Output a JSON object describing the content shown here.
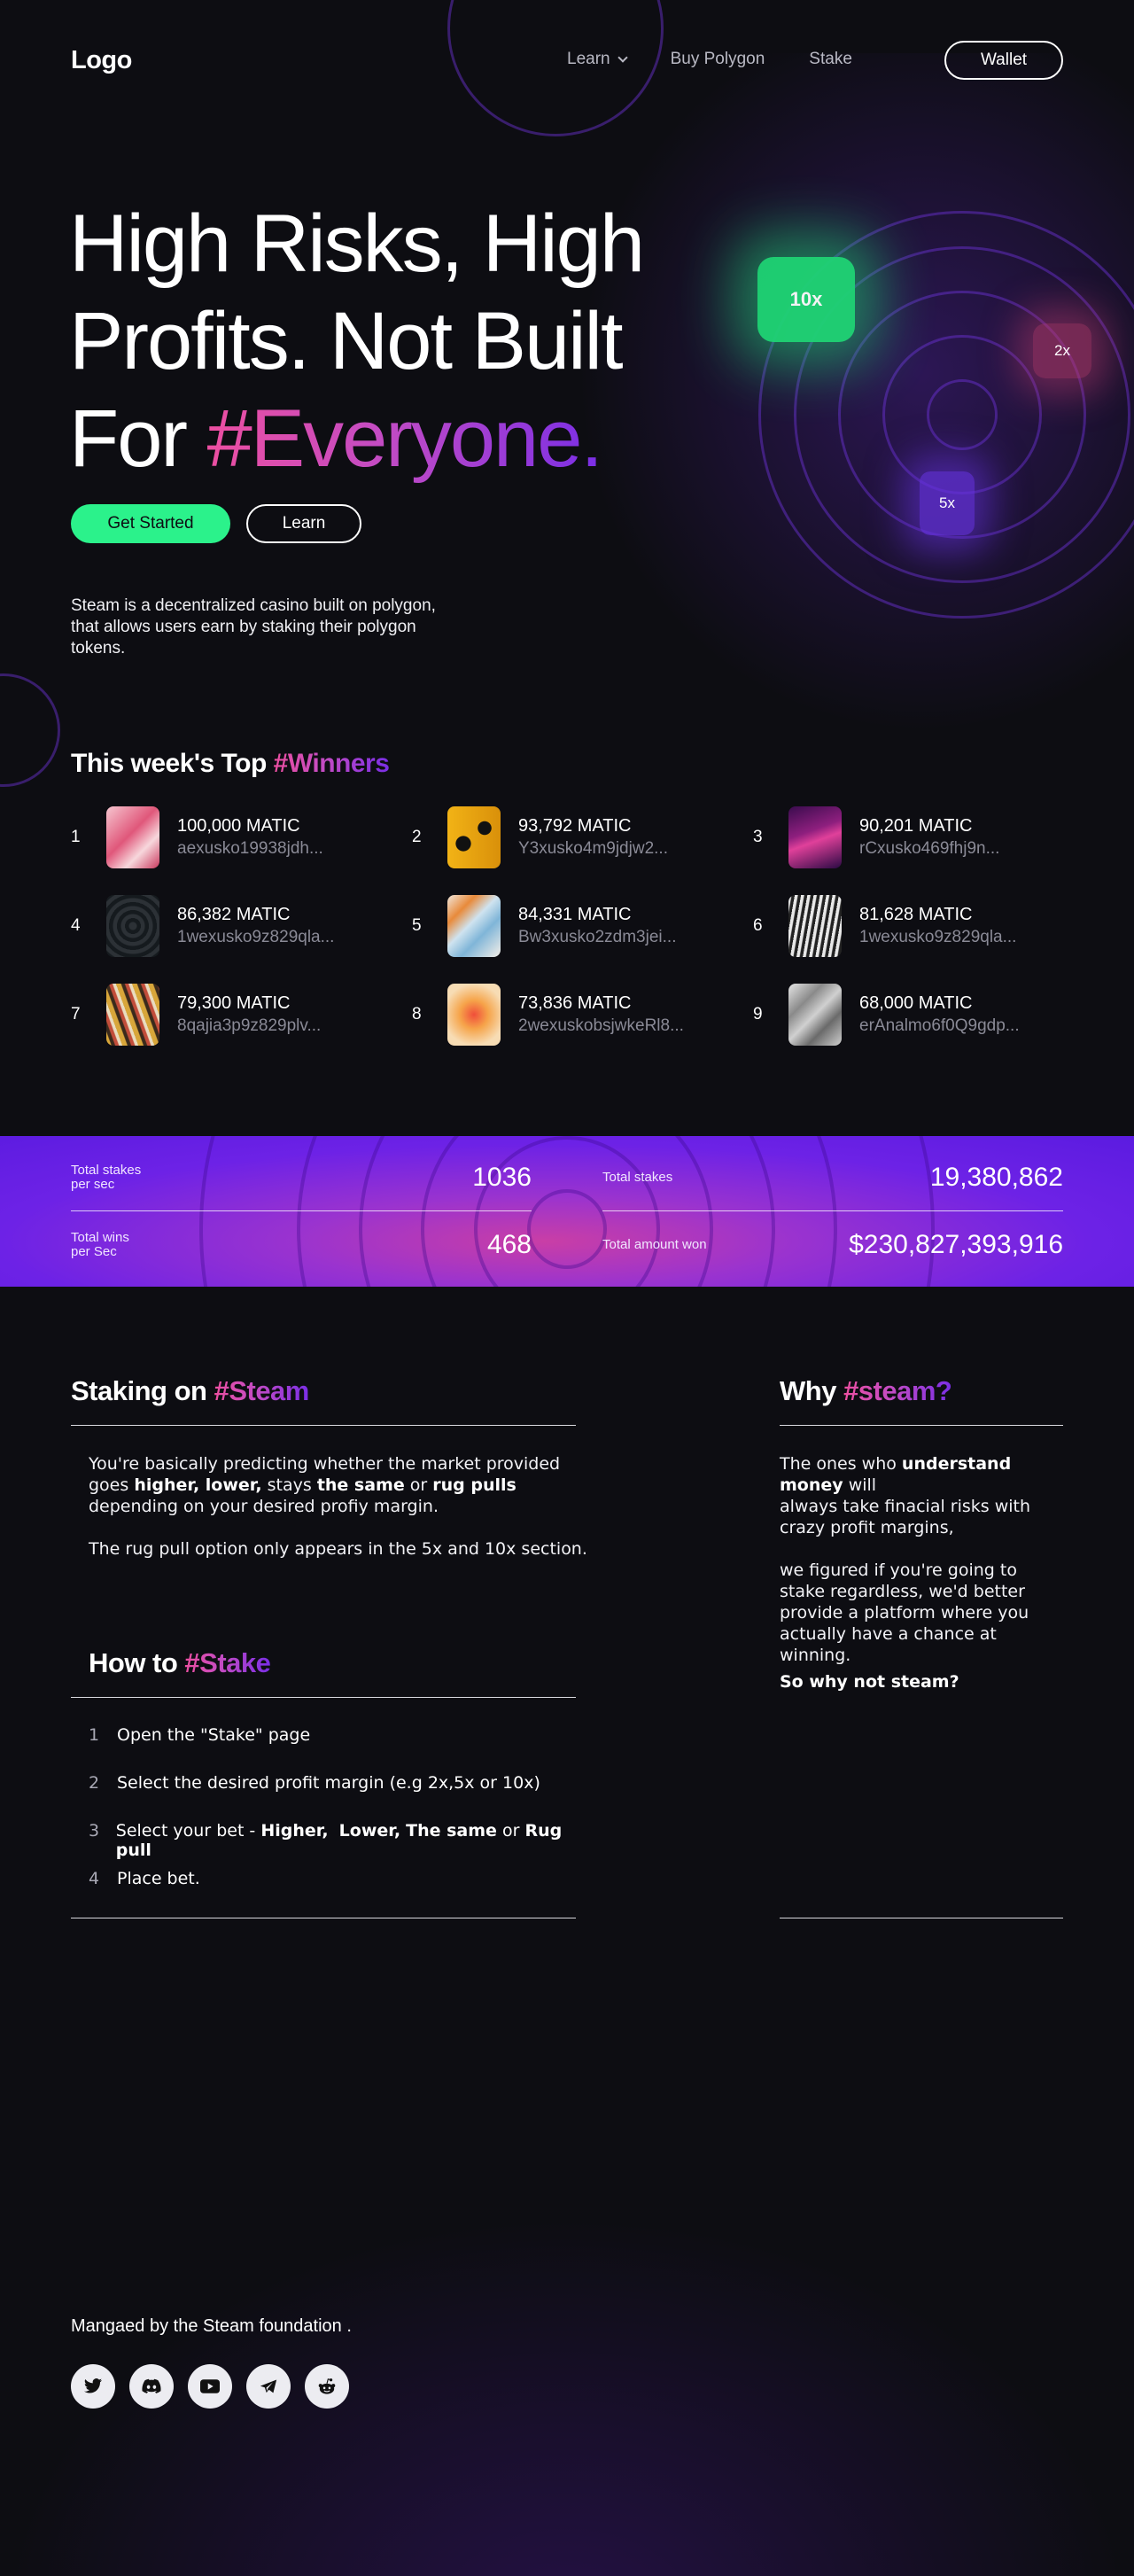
{
  "header": {
    "logo": "Logo",
    "nav": [
      {
        "label": "Learn",
        "has_dropdown": true
      },
      {
        "label": "Buy Polygon"
      },
      {
        "label": "Stake"
      }
    ],
    "wallet_label": "Wallet"
  },
  "hero": {
    "title_line1": "High Risks, High",
    "title_line2": "Profits. Not Built",
    "title_line3_plain": "For ",
    "title_line3_accent": "#Everyone.",
    "primary_button": "Get Started",
    "secondary_button": "Learn",
    "description": "Steam is a decentralized casino built on polygon, that allows users earn by staking their polygon tokens.",
    "multipliers": [
      "10x",
      "2x",
      "5x"
    ]
  },
  "winners": {
    "title_plain": "This week's Top ",
    "title_accent": "#Winners",
    "items": [
      {
        "rank": "1",
        "amount": "100,000 MATIC",
        "address": "aexusko19938jdh..."
      },
      {
        "rank": "2",
        "amount": "93,792 MATIC",
        "address": "Y3xusko4m9jdjw2..."
      },
      {
        "rank": "3",
        "amount": "90,201 MATIC",
        "address": "rCxusko469fhj9n..."
      },
      {
        "rank": "4",
        "amount": "86,382 MATIC",
        "address": "1wexusko9z829qla..."
      },
      {
        "rank": "5",
        "amount": "84,331 MATIC",
        "address": "Bw3xusko2zdm3jei..."
      },
      {
        "rank": "6",
        "amount": "81,628 MATIC",
        "address": "1wexusko9z829qla..."
      },
      {
        "rank": "7",
        "amount": "79,300 MATIC",
        "address": "8qajia3p9z829plv..."
      },
      {
        "rank": "8",
        "amount": "73,836 MATIC",
        "address": "2wexuskobsjwkeRl8..."
      },
      {
        "rank": "9",
        "amount": "68,000 MATIC",
        "address": "erAnalmo6f0Q9gdp..."
      }
    ]
  },
  "stats": {
    "stakes_per_sec_label_1": "Total stakes",
    "stakes_per_sec_label_2": "per sec",
    "stakes_per_sec_value": "1036",
    "total_stakes_label": "Total stakes",
    "total_stakes_value": "19,380,862",
    "wins_per_sec_label_1": "Total wins",
    "wins_per_sec_label_2": "per Sec",
    "wins_per_sec_value": "468",
    "amount_won_label": "Total amount won",
    "amount_won_value": "$230,827,393,916"
  },
  "staking": {
    "title_plain": "Staking on ",
    "title_accent": "#Steam",
    "p1_a": "You're basically predicting whether the market provided goes ",
    "p1_b": "higher, lower,",
    "p1_c": " stays ",
    "p1_d": "the same",
    "p1_e": " or ",
    "p1_f": "rug pulls",
    "p1_g": " depending on your desired profiy margin.",
    "p2": "The rug pull option only appears in the 5x and 10x section."
  },
  "how_to": {
    "title_plain": "How to ",
    "title_accent": "#Stake",
    "steps": [
      {
        "num": "1",
        "text": "Open the \"Stake\" page"
      },
      {
        "num": "2",
        "text": "Select the desired profit margin (e.g 2x,5x or 10x)"
      },
      {
        "num": "3",
        "text_a": "Select your bet - ",
        "b1": "Higher,",
        "b2": "Lower,",
        "b3": "The same",
        "or": " or ",
        "b4": "Rug pull"
      },
      {
        "num": "4",
        "text": "Place bet."
      }
    ]
  },
  "why": {
    "title_plain": "Why ",
    "title_accent": "#steam?",
    "p1_a": "The ones who ",
    "p1_b": "understand money",
    "p1_c": " will",
    "p1_d": "always take finacial risks with crazy profit margins,",
    "p2": "we figured if you're going to stake regardless, we'd better provide a platform where you actually have a chance at winning.",
    "p3": "So why not steam?"
  },
  "footer": {
    "text": "Mangaed by the Steam foundation .",
    "socials": [
      "twitter-icon",
      "discord-icon",
      "youtube-icon",
      "telegram-icon",
      "reddit-icon"
    ]
  },
  "colors": {
    "background": "#0d0d12",
    "accent_green": "#2bf28b",
    "accent_pink": "#ec4fa1",
    "accent_purple": "#7a2ee6"
  }
}
